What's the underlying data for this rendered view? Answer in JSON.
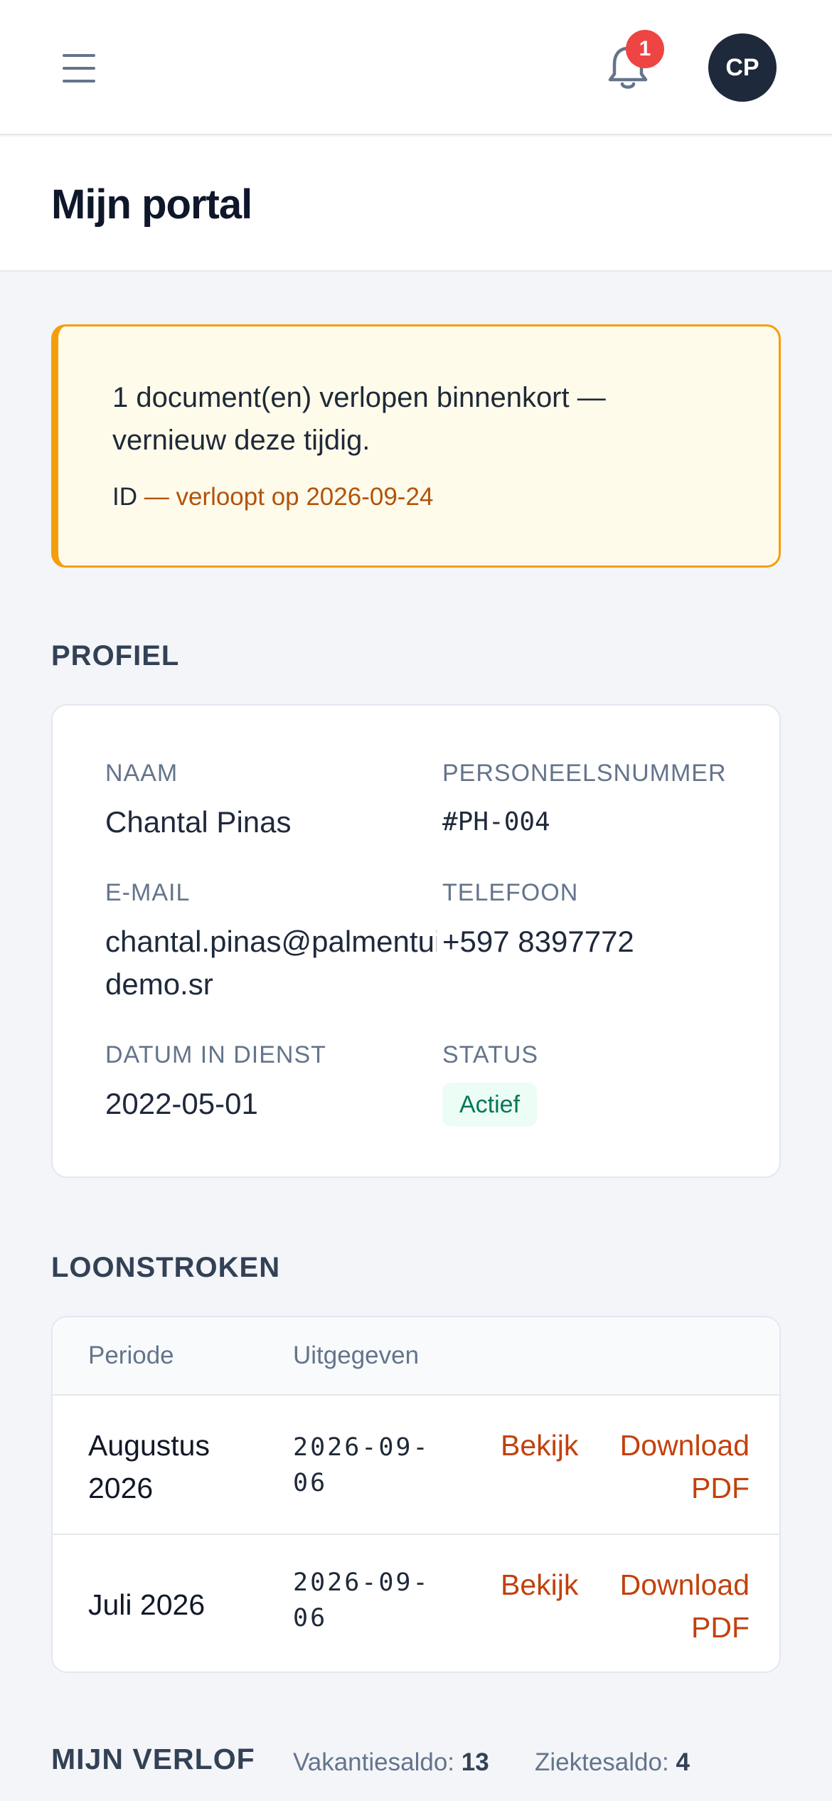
{
  "header": {
    "notifications_count": "1",
    "avatar_initials": "CP",
    "menu_icon": "hamburger-icon",
    "bell_icon": "bell-icon"
  },
  "page": {
    "title": "Mijn portal"
  },
  "alert": {
    "message": "1 document(en) verlopen binnenkort — vernieuw deze tijdig.",
    "document": "ID",
    "expiry": " — verloopt op 2026-09-24"
  },
  "profile": {
    "section_title": "PROFIEL",
    "name_label": "NAAM",
    "name": "Chantal Pinas",
    "employee_number_label": "PERSONEELSNUMMER",
    "employee_number": "#PH-004",
    "email_label": "E-MAIL",
    "email_line1": "chantal.pinas@palmentuin-",
    "email_line2": "demo.sr",
    "phone_label": "TELEFOON",
    "phone": "+597 8397772",
    "start_date_label": "DATUM IN DIENST",
    "start_date": "2022-05-01",
    "status_label": "STATUS",
    "status": "Actief"
  },
  "payslips": {
    "section_title": "LOONSTROKEN",
    "columns": [
      "Periode",
      "Uitgegeven"
    ],
    "rows": [
      {
        "period": "Augustus 2026",
        "issued": "2026-09-06",
        "view": "Bekijk",
        "download": "Download PDF"
      },
      {
        "period": "Juli 2026",
        "issued": "2026-09-06",
        "view": "Bekijk",
        "download": "Download PDF"
      }
    ]
  },
  "leave": {
    "section_title": "MIJN VERLOF",
    "vacation_label": "Vakantiesaldo:",
    "vacation_value": "13",
    "sick_label": "Ziektesaldo:",
    "sick_value": "4"
  }
}
